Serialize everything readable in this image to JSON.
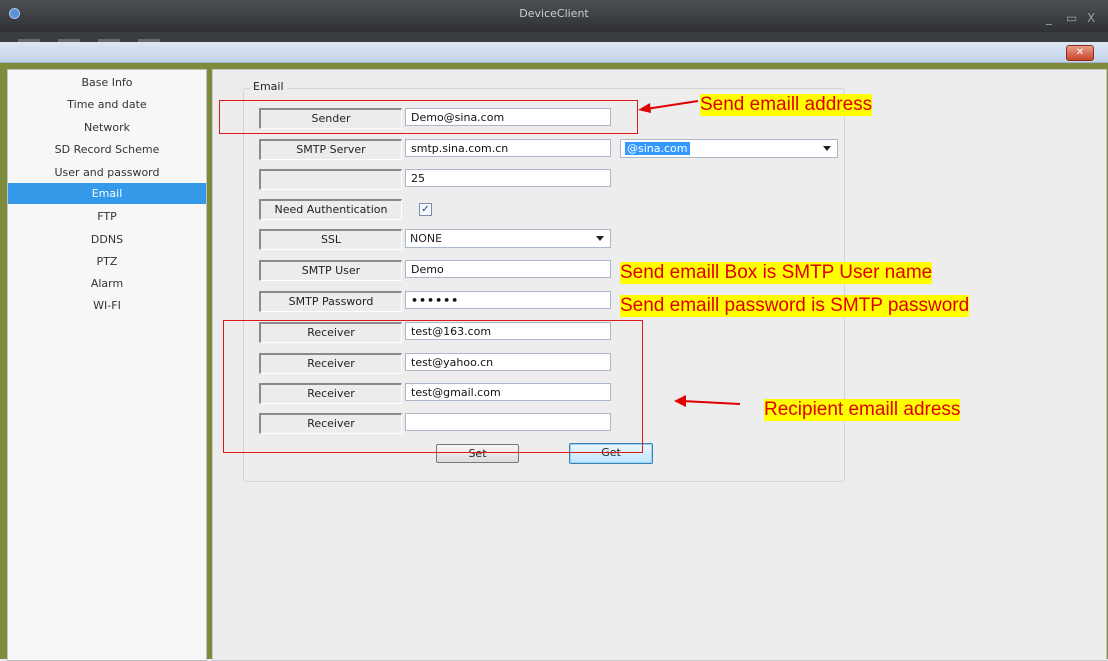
{
  "window": {
    "title": "DeviceClient",
    "controls": [
      "_",
      "▭",
      "X"
    ],
    "close_label": "✕"
  },
  "sidebar": {
    "items": [
      {
        "label": "Base Info"
      },
      {
        "label": "Time and date"
      },
      {
        "label": "Network"
      },
      {
        "label": "SD Record Scheme"
      },
      {
        "label": "User and password"
      },
      {
        "label": "Email",
        "active": true
      },
      {
        "label": "FTP"
      },
      {
        "label": "DDNS"
      },
      {
        "label": "PTZ"
      },
      {
        "label": "Alarm"
      },
      {
        "label": "WI-FI"
      }
    ]
  },
  "email": {
    "group_title": "Email",
    "sender": {
      "label": "Sender",
      "value": "Demo@sina.com"
    },
    "smtp_server": {
      "label": "SMTP Server",
      "value": "smtp.sina.com.cn",
      "domain_selected": "@sina.com"
    },
    "port": {
      "label": "",
      "value": "25"
    },
    "auth": {
      "label": "Need Authentication",
      "checked": "✓"
    },
    "ssl": {
      "label": "SSL",
      "value": "NONE"
    },
    "smtp_user": {
      "label": "SMTP User",
      "value": "Demo"
    },
    "smtp_password": {
      "label": "SMTP Password",
      "value": "••••••"
    },
    "receivers": [
      {
        "label": "Receiver",
        "value": "test@163.com"
      },
      {
        "label": "Receiver",
        "value": "test@yahoo.cn"
      },
      {
        "label": "Receiver",
        "value": "test@gmail.com"
      },
      {
        "label": "Receiver",
        "value": ""
      }
    ],
    "set_label": "Set",
    "get_label": "Get"
  },
  "annotations": {
    "send_address": "Send  emaill address",
    "smtp_user_note": "Send  emaill Box is SMTP User name",
    "smtp_password_note": "Send  emaill password is SMTP password",
    "recipient_note": "Recipient emaill adress",
    "annotation_color": "#e00000",
    "highlight_color": "#ffff00"
  }
}
